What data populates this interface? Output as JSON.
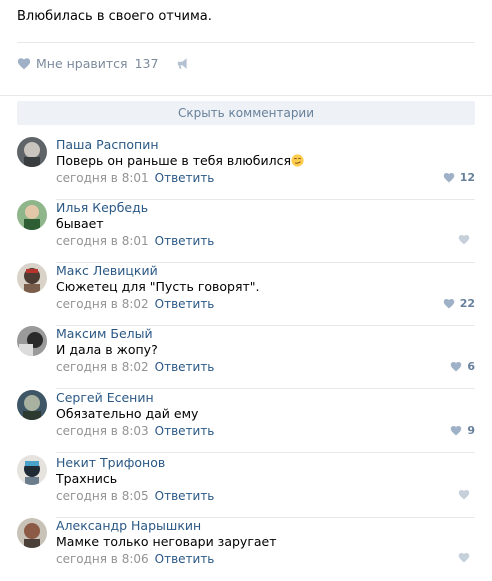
{
  "post": {
    "text": "Влюбилась в своего отчима.",
    "likes_label": "Мне нравится",
    "likes_count": "137",
    "hide_comments": "Скрыть комментарии",
    "colors": {
      "link": "#2a5885",
      "muted": "#939393",
      "like_icon": "#9fb1c6"
    }
  },
  "comments": [
    {
      "name": "Паша Распопин",
      "text": "Поверь он раньше в тебя влюбился",
      "time": "сегодня в 8:01",
      "reply": "Ответить",
      "likes": "12",
      "emoji": "smirk-emoji"
    },
    {
      "name": "Илья Кербедь",
      "text": "бывает",
      "time": "сегодня в 8:01",
      "reply": "Ответить",
      "likes": ""
    },
    {
      "name": "Макс Левицкий",
      "text": "Сюжетец для \"Пусть говорят\".",
      "time": "сегодня в 8:02",
      "reply": "Ответить",
      "likes": "22"
    },
    {
      "name": "Максим Белый",
      "text": "И дала в жопу?",
      "time": "сегодня в 8:02",
      "reply": "Ответить",
      "likes": "6"
    },
    {
      "name": "Сергей Есенин",
      "text": "Обязательно дай ему",
      "time": "сегодня в 8:03",
      "reply": "Ответить",
      "likes": "9"
    },
    {
      "name": "Некит Трифонов",
      "text": "Трахнись",
      "time": "сегодня в 8:05",
      "reply": "Ответить",
      "likes": ""
    },
    {
      "name": "Александр Нарышкин",
      "text": "Мамке только неговари заругает",
      "time": "сегодня в 8:06",
      "reply": "Ответить",
      "likes": ""
    }
  ]
}
